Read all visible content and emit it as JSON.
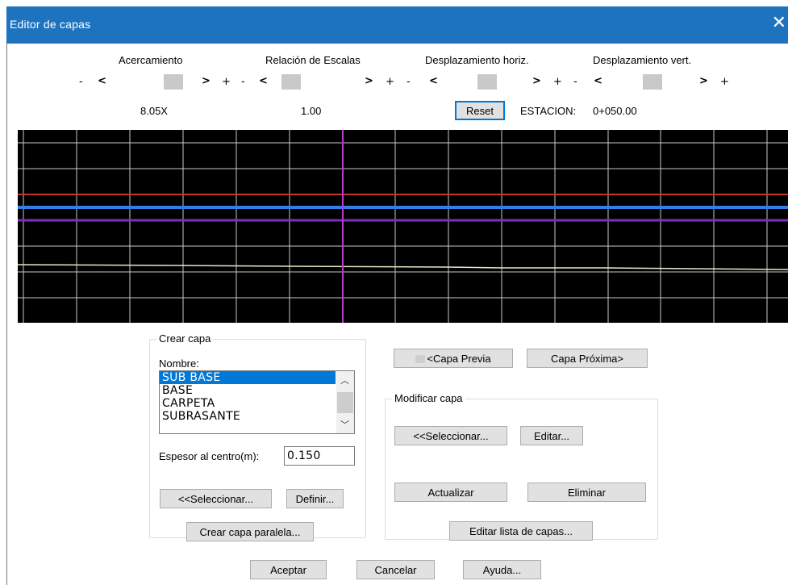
{
  "window": {
    "title": "Editor de capas",
    "close_glyph": "✕"
  },
  "controls": {
    "acercamiento": {
      "label": "Acercamiento",
      "value": "8.05X"
    },
    "relacion": {
      "label": "Relación de Escalas",
      "value": "1.00"
    },
    "despl_horiz": {
      "label": "Desplazamiento horiz."
    },
    "despl_vert": {
      "label": "Desplazamiento vert."
    },
    "minus": "-",
    "plus": "+",
    "left": "<",
    "right": ">",
    "reset_label": "Reset",
    "estacion_label": "ESTACION:",
    "estacion_value": "0+050.00"
  },
  "plot": {
    "background": "#000000",
    "grid_color": "#c8c8c8",
    "line_colors": [
      "#c0392b",
      "#2f7fe6",
      "#7b2fbf",
      "#e8e8c8"
    ],
    "axis_color": "#b43cc8"
  },
  "crear_capa": {
    "title": "Crear capa",
    "nombre_label": "Nombre:",
    "layers": [
      "SUB BASE",
      "BASE",
      "CARPETA",
      "SUBRASANTE"
    ],
    "selected_layer": "SUB BASE",
    "espesor_label": "Espesor al centro(m):",
    "espesor_value": "0.150",
    "seleccionar_label": "<<Seleccionar...",
    "definir_label": "Definir...",
    "paralela_label": "Crear capa paralela..."
  },
  "nav": {
    "previa_label": "<Capa Previa",
    "proxima_label": "Capa Próxima>"
  },
  "modificar_capa": {
    "title": "Modificar capa",
    "seleccionar_label": "<<Seleccionar...",
    "editar_label": "Editar...",
    "actualizar_label": "Actualizar",
    "eliminar_label": "Eliminar",
    "editar_lista_label": "Editar lista de capas..."
  },
  "footer": {
    "aceptar_label": "Aceptar",
    "cancelar_label": "Cancelar",
    "ayuda_label": "Ayuda..."
  }
}
